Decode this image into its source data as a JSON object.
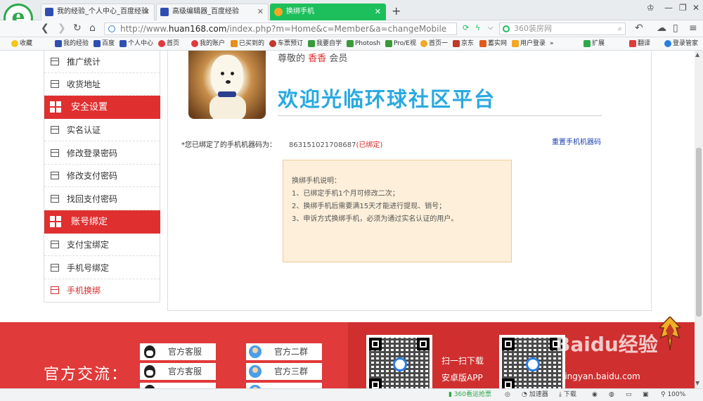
{
  "browser": {
    "tabs": [
      {
        "title": "我的经验_个人中心_百度经验",
        "active": false
      },
      {
        "title": "高级编辑器_百度经验",
        "active": false
      },
      {
        "title": "换绑手机",
        "active": true
      }
    ],
    "new_tab": "+",
    "address": {
      "prefix": "http://www.",
      "domain": "huan168.com",
      "path": "/index.php?m=Home&c=Member&a=changeMobile"
    },
    "search_placeholder": "360装房网",
    "bookmarks": [
      "收藏",
      "我的经验",
      "百度",
      "个人中心",
      "首页",
      "我的账户",
      "已买到的",
      "车票预订",
      "我要自学",
      "Photosh",
      "Pro/E视",
      "首页一",
      "京东",
      "蓄实网",
      "用户登录",
      "»",
      "扩展",
      "翻译",
      "登录管家"
    ],
    "status": {
      "ad": "360看运抢票",
      "accelerator": "加速器",
      "download": "下载",
      "zoom": "100%"
    }
  },
  "sidebar": {
    "items_top": [
      {
        "label": "推广统计"
      },
      {
        "label": "收货地址"
      }
    ],
    "section_security": "安全设置",
    "items_security": [
      {
        "label": "实名认证"
      },
      {
        "label": "修改登录密码"
      },
      {
        "label": "修改支付密码"
      },
      {
        "label": "找回支付密码"
      }
    ],
    "section_binding": "账号绑定",
    "items_binding": [
      {
        "label": "支付宝绑定",
        "active": false
      },
      {
        "label": "手机号绑定",
        "active": false
      },
      {
        "label": "手机换绑",
        "active": true
      }
    ]
  },
  "profile": {
    "greeting_prefix": "尊敬的",
    "username": "香香",
    "greeting_suffix": "会员",
    "welcome": "欢迎光临环球社区平台"
  },
  "binding": {
    "label": "*您已绑定了的手机机器码为：",
    "code": "863151021708687",
    "state": "(已绑定)",
    "reset_link": "重置手机机器码"
  },
  "notice": {
    "title": "换绑手机说明：",
    "lines": [
      "1、已绑定手机1个月可修改二次；",
      "2、换绑手机后需要满15天才能进行提现、销号；",
      "3、申诉方式换绑手机，必须为通过实名认证的用户。"
    ]
  },
  "footer": {
    "title": "官方交流：",
    "groups": [
      "官方客服",
      "官方客服",
      "官方二群",
      "官方三群"
    ],
    "qr_caption_1": "扫一扫下载",
    "qr_caption_2": "安卓版APP",
    "watermark": "Baidu经验",
    "watermark_url": "jingyan.baidu.com"
  },
  "colors": {
    "brand_red": "#e02f2f",
    "welcome_blue": "#29a9e0",
    "tab_green": "#1dbf5c",
    "notice_bg": "#fdefd9"
  },
  "icons": [
    "logo-icon",
    "favicon-icon",
    "close-icon",
    "back-icon",
    "forward-icon",
    "refresh-icon",
    "home-icon",
    "globe-icon",
    "search-icon",
    "grid-icon",
    "list-icon",
    "qq-icon",
    "person-icon",
    "qr-code",
    "mascot-icon"
  ]
}
